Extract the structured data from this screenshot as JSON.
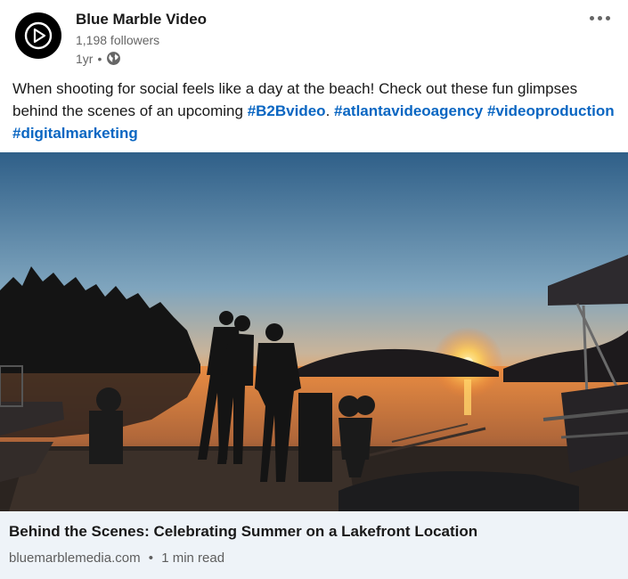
{
  "post": {
    "author": "Blue Marble Video",
    "followers": "1,198 followers",
    "age": "1yr",
    "separator": "•",
    "text_parts": {
      "p1": "When shooting for social feels like a day at the beach! Check out these fun glimpses behind the scenes of an upcoming ",
      "h1": "#B2Bvideo",
      "p2": ".  ",
      "h2": "#atlantavideoagency",
      "p3": " ",
      "h3": "#videoproduction",
      "p4": " ",
      "h4": "#digitalmarketing"
    }
  },
  "link_card": {
    "title": "Behind the Scenes: Celebrating Summer on a Lakefront Location",
    "domain": "bluemarblemedia.com",
    "separator": "•",
    "read_time": "1 min read"
  },
  "icons": {
    "avatar": "play-logo",
    "visibility": "globe-icon",
    "menu": "more-options-icon"
  },
  "colors": {
    "hashtag": "#0a66c2",
    "card_bg": "#eef3f8"
  }
}
